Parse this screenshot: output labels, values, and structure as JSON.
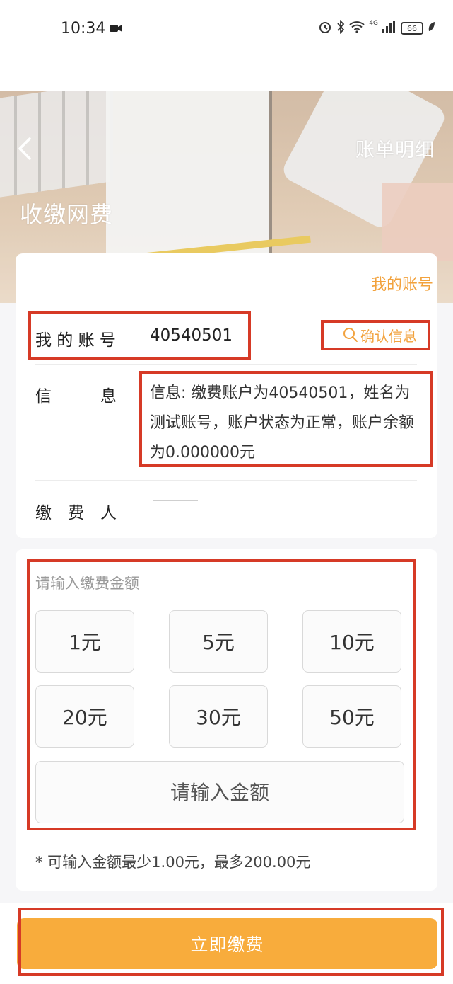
{
  "status_bar": {
    "time": "10:34",
    "network": "4G",
    "battery": "66"
  },
  "header": {
    "title": "收缴网费",
    "bill_detail_label": "账单明细"
  },
  "account_card": {
    "my_account_link": "我的账号",
    "account_label": "我 的 账 号",
    "account_value": "40540501",
    "confirm_label": "确认信息",
    "info_label": "信　　　息",
    "info_text": "信息: 缴费账户为40540501，姓名为测试账号，账户状态为正常，账户余额为0.000000元",
    "payer_label": "缴　费　人",
    "payer_value": ""
  },
  "amount_card": {
    "prompt": "请输入缴费金额",
    "amounts": [
      "1元",
      "5元",
      "10元",
      "20元",
      "30元",
      "50元"
    ],
    "custom_placeholder": "请输入金额",
    "hint": "* 可输入金额最少1.00元，最多200.00元"
  },
  "pay_button_label": "立即缴费",
  "colors": {
    "accent": "#f2a23d",
    "pay_button": "#f8ac3c",
    "annotation": "#d63a26"
  }
}
